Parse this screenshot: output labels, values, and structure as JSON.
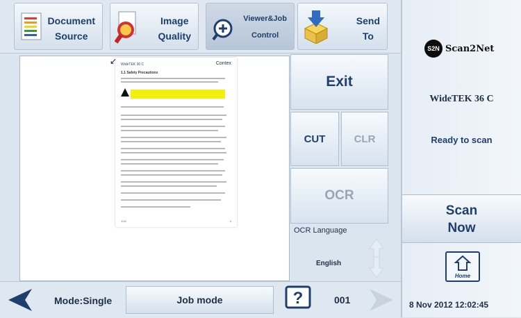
{
  "toolbar": {
    "document_source_label": "Document\nSource",
    "image_quality_label": "Image\nQuality",
    "viewer_job_control_label": "Viewer&Job\nControl",
    "send_to_label": "Send\nTo"
  },
  "preview": {
    "page_header_left": "WideTEK 36 C",
    "page_header_right": "Contex",
    "section_title": "1.1  Safety Precautions",
    "footer_left": "1/16",
    "footer_right": "2"
  },
  "controls": {
    "exit_label": "Exit",
    "cut_label": "CUT",
    "clr_label": "CLR",
    "ocr_label": "OCR",
    "ocr_language_label": "OCR Language",
    "ocr_language_value": "English"
  },
  "bottom": {
    "mode_label": "Mode:Single",
    "job_mode_label": "Job mode",
    "help_label": "?",
    "page_counter": "001"
  },
  "right_panel": {
    "logo_text_a": "S2N",
    "logo_text_b": "Scan2Net",
    "model": "WideTEK 36 C",
    "status": "Ready to scan",
    "scan_now_line1": "Scan",
    "scan_now_line2": "Now",
    "home_label": "Home",
    "datetime": "8 Nov 2012 12:02:45"
  },
  "colors": {
    "accent_dark": "#1e3f6e",
    "disabled": "#9aa5b1",
    "warning_yellow": "#f5f00a"
  },
  "icons": [
    "document-icon",
    "magnifier-icon",
    "zoom-icon",
    "send-box-icon",
    "back-arrow-icon",
    "forward-arrow-icon",
    "help-icon",
    "home-icon",
    "up-arrow-icon",
    "down-arrow-icon",
    "warning-icon"
  ]
}
